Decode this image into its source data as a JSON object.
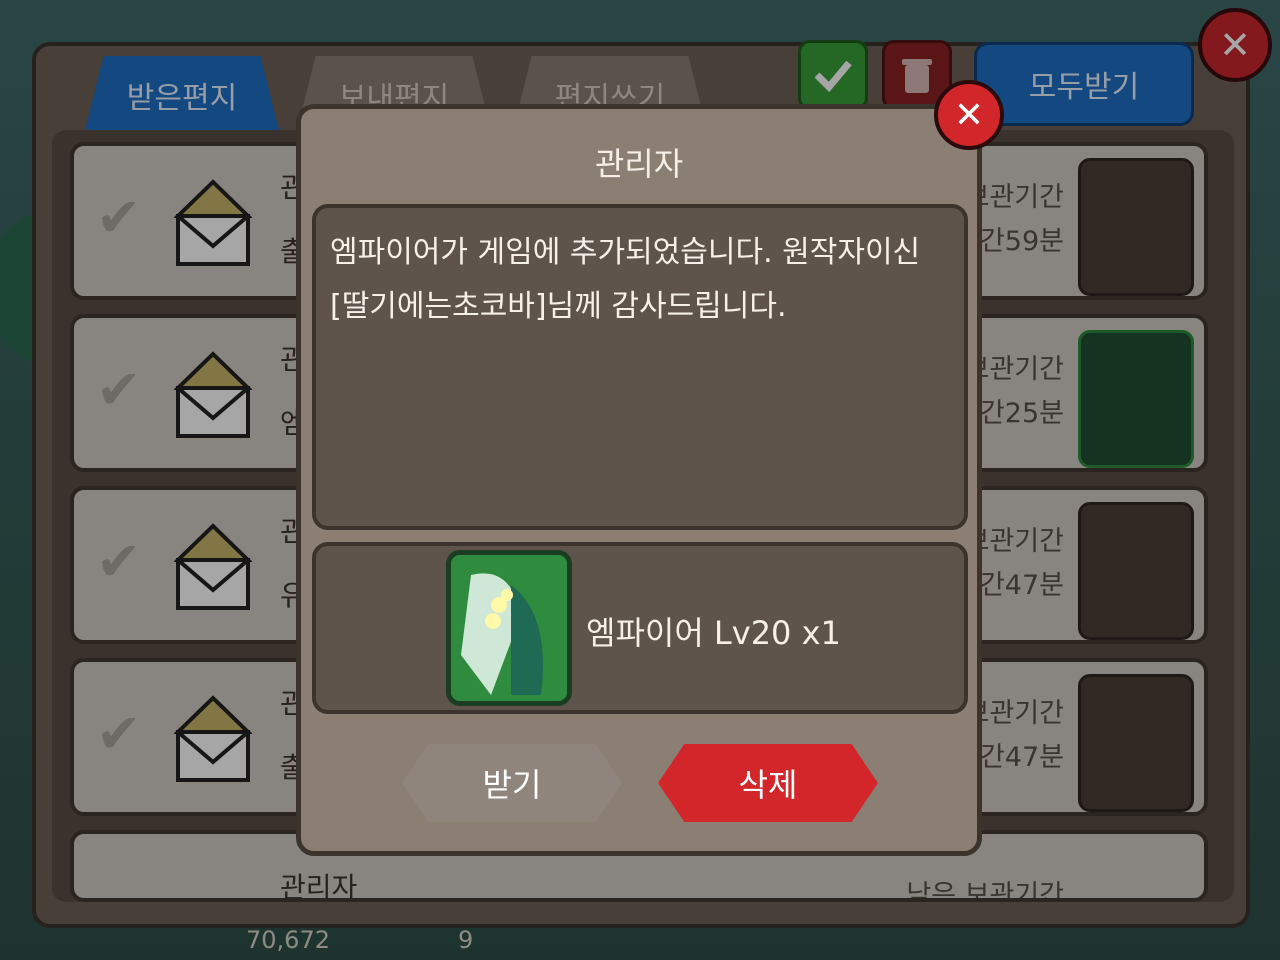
{
  "tabs": [
    "받은편지",
    "보내편지",
    "편지쓰기"
  ],
  "receive_all_label": "모두받기",
  "rows": [
    {
      "sender": "관",
      "subject": "출",
      "expire_label": "보관기간",
      "expire_time": "시간59분"
    },
    {
      "sender": "관",
      "subject": "엠",
      "expire_label": "보관기간",
      "expire_time": "시간25분"
    },
    {
      "sender": "관",
      "subject": "유",
      "expire_label": "보관기간",
      "expire_time": "시간47분"
    },
    {
      "sender": "관",
      "subject": "출",
      "expire_label": "보관기간",
      "expire_time": "시간47분"
    },
    {
      "sender": "관리자",
      "subject": "",
      "expire_label": "남은 보관기간",
      "expire_time": ""
    }
  ],
  "dialog": {
    "title": "관리자",
    "message_line1": "엠파이어가 게임에 추가되었습니다. 원작자이신",
    "message_line2": "[딸기에는초코바]님께 감사드립니다.",
    "item_text": "엠파이어 Lv20 x1",
    "receive_label": "받기",
    "delete_label": "삭제"
  },
  "footer": {
    "gold": "70,672",
    "gems": "9"
  }
}
